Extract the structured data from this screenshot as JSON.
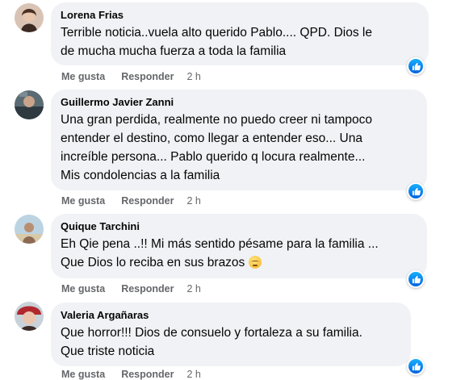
{
  "comments": [
    {
      "author": "Lorena Frias",
      "text": "Terrible noticia..vuela alto querido Pablo.... QPD. Dios le\nde mucha mucha fuerza a toda la familia",
      "like_label": "Me gusta",
      "reply_label": "Responder",
      "time": "2 h"
    },
    {
      "author": "Guillermo Javier Zanni",
      "text": "Una gran perdida, realmente no puedo creer ni tampoco\nentender el destino, como llegar a entender eso... Una\nincreíble persona... Pablo querido q locura realmente...\nMis condolencias a la familia",
      "like_label": "Me gusta",
      "reply_label": "Responder",
      "time": "2 h"
    },
    {
      "author": "Quique Tarchini",
      "text_line1": "Eh Qie pena ..!! Mi más sentido pésame para la familia ...",
      "text_line2": "Que Dios lo reciba en sus brazos",
      "emoji_icon": "pensive-face-emoji",
      "like_label": "Me gusta",
      "reply_label": "Responder",
      "time": "2 h"
    },
    {
      "author": "Valeria Argañaras",
      "text": "Que horror!!! Dios de consuelo y fortaleza a su familia.\nQue triste noticia",
      "like_label": "Me gusta",
      "reply_label": "Responder",
      "time": "2 h"
    }
  ],
  "reaction_icon": "like-reaction-icon",
  "colors": {
    "bubble": "#f0f2f5",
    "text": "#050505",
    "secondary": "#65676b",
    "like_blue": "#1877f2"
  }
}
